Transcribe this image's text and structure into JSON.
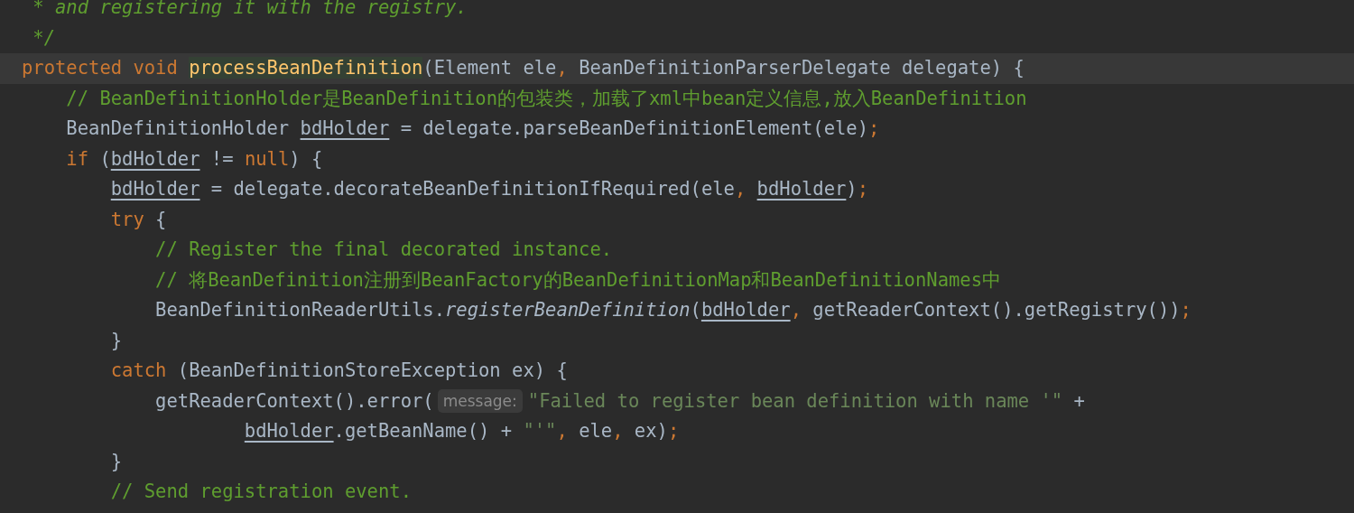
{
  "editor": {
    "lines": [
      {
        "current": false,
        "tokens": [
          {
            "kind": "doc",
            "text": " * and registering it with the registry."
          }
        ]
      },
      {
        "current": false,
        "tokens": [
          {
            "kind": "doc",
            "text": " */"
          }
        ]
      },
      {
        "current": true,
        "tokens": [
          {
            "kind": "keyword",
            "text": "protected void "
          },
          {
            "kind": "decl",
            "text": "processBeanDefinition"
          },
          {
            "kind": "plain",
            "text": "(Element ele"
          },
          {
            "kind": "punct",
            "text": ", "
          },
          {
            "kind": "plain",
            "text": "BeanDefinitionParserDelegate delegate) {"
          }
        ]
      },
      {
        "current": false,
        "tokens": [
          {
            "kind": "comment",
            "text": "    // BeanDefinitionHolder是BeanDefinition的包装类，加载了xml中bean定义信息,放入BeanDefinition"
          }
        ]
      },
      {
        "current": false,
        "tokens": [
          {
            "kind": "plain",
            "text": "    BeanDefinitionHolder "
          },
          {
            "kind": "field",
            "text": "bdHolder"
          },
          {
            "kind": "plain",
            "text": " = delegate.parseBeanDefinitionElement(ele)"
          },
          {
            "kind": "punct",
            "text": ";"
          }
        ]
      },
      {
        "current": false,
        "tokens": [
          {
            "kind": "keyword",
            "text": "    if "
          },
          {
            "kind": "plain",
            "text": "("
          },
          {
            "kind": "field",
            "text": "bdHolder"
          },
          {
            "kind": "plain",
            "text": " != "
          },
          {
            "kind": "keyword",
            "text": "null"
          },
          {
            "kind": "plain",
            "text": ") {"
          }
        ]
      },
      {
        "current": false,
        "tokens": [
          {
            "kind": "field",
            "text": "        bdHolder"
          },
          {
            "kind": "plain",
            "text": " = delegate.decorateBeanDefinitionIfRequired(ele"
          },
          {
            "kind": "punct",
            "text": ", "
          },
          {
            "kind": "field",
            "text": "bdHolder"
          },
          {
            "kind": "plain",
            "text": ")"
          },
          {
            "kind": "punct",
            "text": ";"
          }
        ]
      },
      {
        "current": false,
        "tokens": [
          {
            "kind": "keyword",
            "text": "        try "
          },
          {
            "kind": "plain",
            "text": "{"
          }
        ]
      },
      {
        "current": false,
        "tokens": [
          {
            "kind": "comment",
            "text": "            // Register the final decorated instance."
          }
        ]
      },
      {
        "current": false,
        "tokens": [
          {
            "kind": "comment",
            "text": "            // 将BeanDefinition注册到BeanFactory的BeanDefinitionMap和BeanDefinitionNames中"
          }
        ]
      },
      {
        "current": false,
        "tokens": [
          {
            "kind": "plain",
            "text": "            BeanDefinitionReaderUtils."
          },
          {
            "kind": "static",
            "text": "registerBeanDefinition"
          },
          {
            "kind": "plain",
            "text": "("
          },
          {
            "kind": "field",
            "text": "bdHolder"
          },
          {
            "kind": "punct",
            "text": ", "
          },
          {
            "kind": "plain",
            "text": "getReaderContext().getRegistry())"
          },
          {
            "kind": "punct",
            "text": ";"
          }
        ]
      },
      {
        "current": false,
        "tokens": [
          {
            "kind": "plain",
            "text": "        }"
          }
        ]
      },
      {
        "current": false,
        "tokens": [
          {
            "kind": "keyword",
            "text": "        catch "
          },
          {
            "kind": "plain",
            "text": "(BeanDefinitionStoreException ex) {"
          }
        ]
      },
      {
        "current": false,
        "tokens": [
          {
            "kind": "plain",
            "text": "            getReaderContext().error("
          },
          {
            "kind": "hint",
            "text": "message:"
          },
          {
            "kind": "string",
            "text": "\"Failed to register bean definition with name '\""
          },
          {
            "kind": "plain",
            "text": " +"
          }
        ]
      },
      {
        "current": false,
        "tokens": [
          {
            "kind": "field",
            "text": "                    bdHolder"
          },
          {
            "kind": "plain",
            "text": ".getBeanName() + "
          },
          {
            "kind": "string",
            "text": "\"'\""
          },
          {
            "kind": "punct",
            "text": ", "
          },
          {
            "kind": "plain",
            "text": "ele"
          },
          {
            "kind": "punct",
            "text": ", "
          },
          {
            "kind": "plain",
            "text": "ex)"
          },
          {
            "kind": "punct",
            "text": ";"
          }
        ]
      },
      {
        "current": false,
        "tokens": [
          {
            "kind": "plain",
            "text": "        }"
          }
        ]
      },
      {
        "current": false,
        "tokens": [
          {
            "kind": "comment",
            "text": "        // Send registration event."
          }
        ]
      }
    ]
  }
}
